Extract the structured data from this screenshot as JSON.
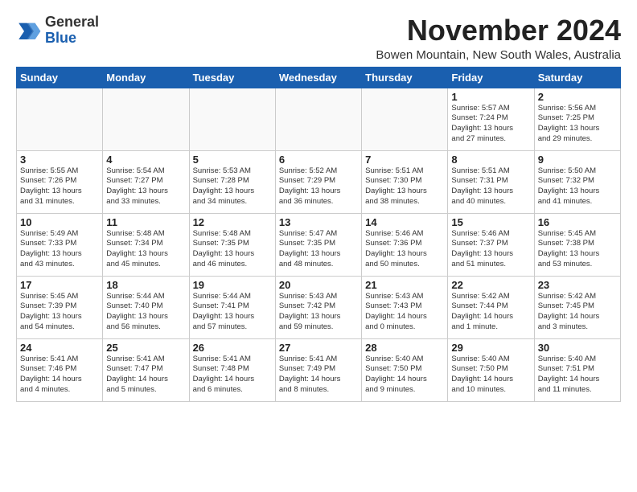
{
  "header": {
    "logo_general": "General",
    "logo_blue": "Blue",
    "month_title": "November 2024",
    "location": "Bowen Mountain, New South Wales, Australia"
  },
  "weekdays": [
    "Sunday",
    "Monday",
    "Tuesday",
    "Wednesday",
    "Thursday",
    "Friday",
    "Saturday"
  ],
  "weeks": [
    [
      {
        "day": "",
        "info": ""
      },
      {
        "day": "",
        "info": ""
      },
      {
        "day": "",
        "info": ""
      },
      {
        "day": "",
        "info": ""
      },
      {
        "day": "",
        "info": ""
      },
      {
        "day": "1",
        "info": "Sunrise: 5:57 AM\nSunset: 7:24 PM\nDaylight: 13 hours\nand 27 minutes."
      },
      {
        "day": "2",
        "info": "Sunrise: 5:56 AM\nSunset: 7:25 PM\nDaylight: 13 hours\nand 29 minutes."
      }
    ],
    [
      {
        "day": "3",
        "info": "Sunrise: 5:55 AM\nSunset: 7:26 PM\nDaylight: 13 hours\nand 31 minutes."
      },
      {
        "day": "4",
        "info": "Sunrise: 5:54 AM\nSunset: 7:27 PM\nDaylight: 13 hours\nand 33 minutes."
      },
      {
        "day": "5",
        "info": "Sunrise: 5:53 AM\nSunset: 7:28 PM\nDaylight: 13 hours\nand 34 minutes."
      },
      {
        "day": "6",
        "info": "Sunrise: 5:52 AM\nSunset: 7:29 PM\nDaylight: 13 hours\nand 36 minutes."
      },
      {
        "day": "7",
        "info": "Sunrise: 5:51 AM\nSunset: 7:30 PM\nDaylight: 13 hours\nand 38 minutes."
      },
      {
        "day": "8",
        "info": "Sunrise: 5:51 AM\nSunset: 7:31 PM\nDaylight: 13 hours\nand 40 minutes."
      },
      {
        "day": "9",
        "info": "Sunrise: 5:50 AM\nSunset: 7:32 PM\nDaylight: 13 hours\nand 41 minutes."
      }
    ],
    [
      {
        "day": "10",
        "info": "Sunrise: 5:49 AM\nSunset: 7:33 PM\nDaylight: 13 hours\nand 43 minutes."
      },
      {
        "day": "11",
        "info": "Sunrise: 5:48 AM\nSunset: 7:34 PM\nDaylight: 13 hours\nand 45 minutes."
      },
      {
        "day": "12",
        "info": "Sunrise: 5:48 AM\nSunset: 7:35 PM\nDaylight: 13 hours\nand 46 minutes."
      },
      {
        "day": "13",
        "info": "Sunrise: 5:47 AM\nSunset: 7:35 PM\nDaylight: 13 hours\nand 48 minutes."
      },
      {
        "day": "14",
        "info": "Sunrise: 5:46 AM\nSunset: 7:36 PM\nDaylight: 13 hours\nand 50 minutes."
      },
      {
        "day": "15",
        "info": "Sunrise: 5:46 AM\nSunset: 7:37 PM\nDaylight: 13 hours\nand 51 minutes."
      },
      {
        "day": "16",
        "info": "Sunrise: 5:45 AM\nSunset: 7:38 PM\nDaylight: 13 hours\nand 53 minutes."
      }
    ],
    [
      {
        "day": "17",
        "info": "Sunrise: 5:45 AM\nSunset: 7:39 PM\nDaylight: 13 hours\nand 54 minutes."
      },
      {
        "day": "18",
        "info": "Sunrise: 5:44 AM\nSunset: 7:40 PM\nDaylight: 13 hours\nand 56 minutes."
      },
      {
        "day": "19",
        "info": "Sunrise: 5:44 AM\nSunset: 7:41 PM\nDaylight: 13 hours\nand 57 minutes."
      },
      {
        "day": "20",
        "info": "Sunrise: 5:43 AM\nSunset: 7:42 PM\nDaylight: 13 hours\nand 59 minutes."
      },
      {
        "day": "21",
        "info": "Sunrise: 5:43 AM\nSunset: 7:43 PM\nDaylight: 14 hours\nand 0 minutes."
      },
      {
        "day": "22",
        "info": "Sunrise: 5:42 AM\nSunset: 7:44 PM\nDaylight: 14 hours\nand 1 minute."
      },
      {
        "day": "23",
        "info": "Sunrise: 5:42 AM\nSunset: 7:45 PM\nDaylight: 14 hours\nand 3 minutes."
      }
    ],
    [
      {
        "day": "24",
        "info": "Sunrise: 5:41 AM\nSunset: 7:46 PM\nDaylight: 14 hours\nand 4 minutes."
      },
      {
        "day": "25",
        "info": "Sunrise: 5:41 AM\nSunset: 7:47 PM\nDaylight: 14 hours\nand 5 minutes."
      },
      {
        "day": "26",
        "info": "Sunrise: 5:41 AM\nSunset: 7:48 PM\nDaylight: 14 hours\nand 6 minutes."
      },
      {
        "day": "27",
        "info": "Sunrise: 5:41 AM\nSunset: 7:49 PM\nDaylight: 14 hours\nand 8 minutes."
      },
      {
        "day": "28",
        "info": "Sunrise: 5:40 AM\nSunset: 7:50 PM\nDaylight: 14 hours\nand 9 minutes."
      },
      {
        "day": "29",
        "info": "Sunrise: 5:40 AM\nSunset: 7:50 PM\nDaylight: 14 hours\nand 10 minutes."
      },
      {
        "day": "30",
        "info": "Sunrise: 5:40 AM\nSunset: 7:51 PM\nDaylight: 14 hours\nand 11 minutes."
      }
    ]
  ]
}
